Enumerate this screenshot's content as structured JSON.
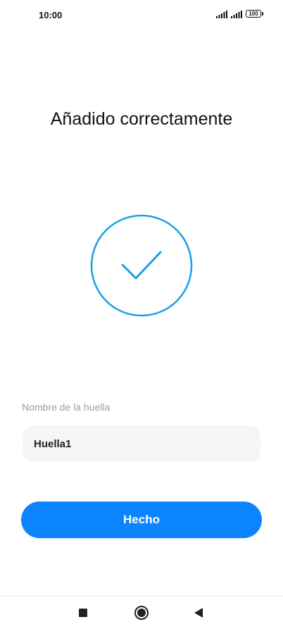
{
  "status_bar": {
    "time": "10:00",
    "battery": "100",
    "icons": [
      "signal-icon",
      "signal-icon",
      "battery-icon"
    ]
  },
  "title": "Añadido correctamente",
  "success_icon": "checkmark-circle-icon",
  "fingerprint_name": {
    "label": "Nombre de la huella",
    "value": "Huella1"
  },
  "done_button": {
    "label": "Hecho"
  },
  "nav_bar": {
    "icons": [
      "recent-apps-icon",
      "home-icon",
      "back-icon"
    ]
  },
  "colors": {
    "accent": "#0d84ff",
    "check": "#1a9fe8",
    "input_bg": "#f5f5f5",
    "label": "#9e9e9e"
  }
}
